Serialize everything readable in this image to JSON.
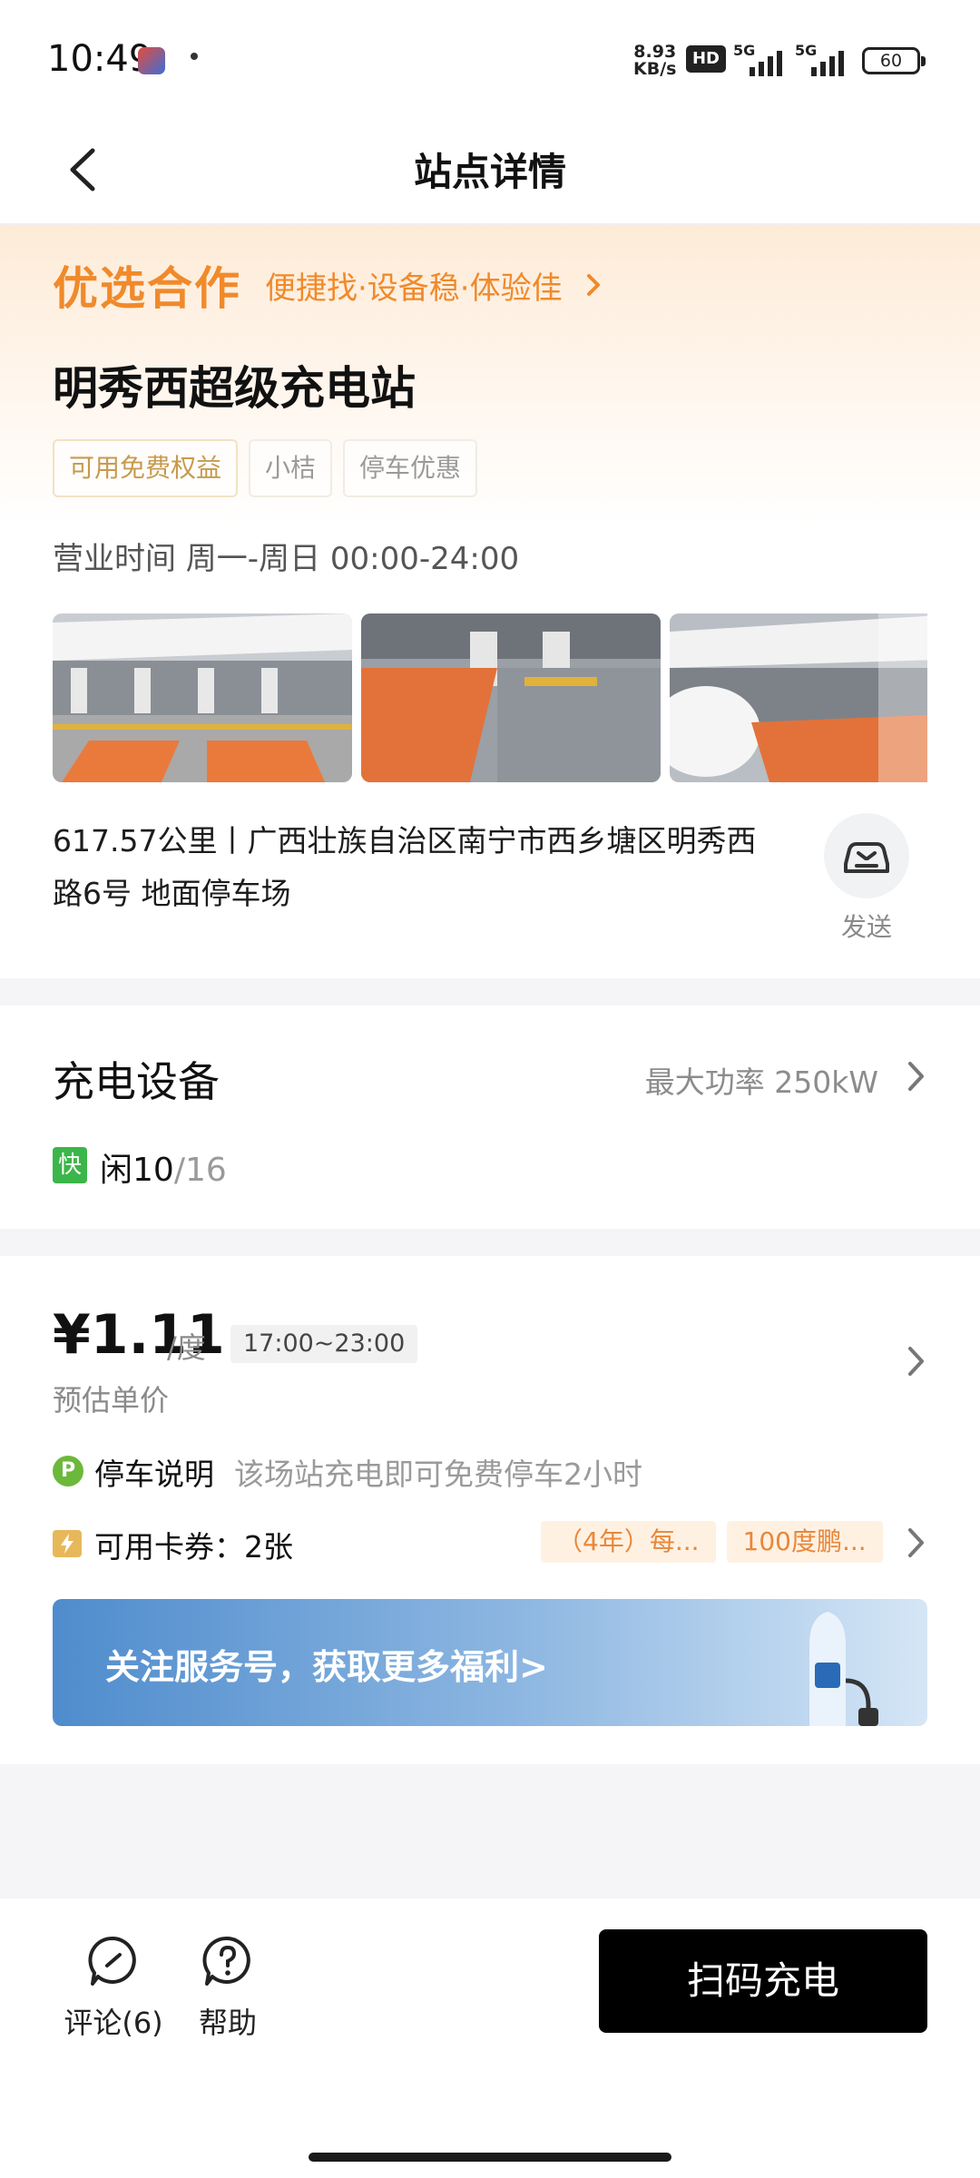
{
  "status": {
    "time": "10:49",
    "net_speed_value": "8.93",
    "net_speed_unit": "KB/s",
    "hd": "HD",
    "sim1": "5G",
    "sim2": "5G",
    "battery": "60"
  },
  "nav": {
    "title": "站点详情"
  },
  "station": {
    "promo_title": "优选合作",
    "promo_subtitle": "便捷找·设备稳·体验佳",
    "name": "明秀西超级充电站",
    "tags": [
      "可用免费权益",
      "小桔",
      "停车优惠"
    ],
    "hours": "营业时间 周一-周日 00:00-24:00",
    "address": "617.57公里丨广西壮族自治区南宁市西乡塘区明秀西路6号 地面停车场",
    "send_label": "发送"
  },
  "equipment": {
    "title": "充电设备",
    "max_power": "最大功率 250kW",
    "fast_badge": "快",
    "idle_label": "闲10",
    "idle_total": "/16"
  },
  "price": {
    "amount": "¥1.11",
    "unit": "/度",
    "time_range": "17:00~23:00",
    "caption": "预估单价",
    "parking_icon": "P",
    "parking_title": "停车说明",
    "parking_desc": "该场站充电即可免费停车2小时",
    "coupon_text": "可用卡券：2张",
    "coupon_chips": [
      "（4年）每...",
      "100度鹏..."
    ],
    "banner_text": "关注服务号，获取更多福利>"
  },
  "bottom": {
    "comment_label": "评论(6)",
    "help_label": "帮助",
    "scan_label": "扫码充电"
  },
  "colors": {
    "accent_orange": "#f08a2b",
    "fast_green": "#3cb54a",
    "primary_button": "#000000"
  }
}
